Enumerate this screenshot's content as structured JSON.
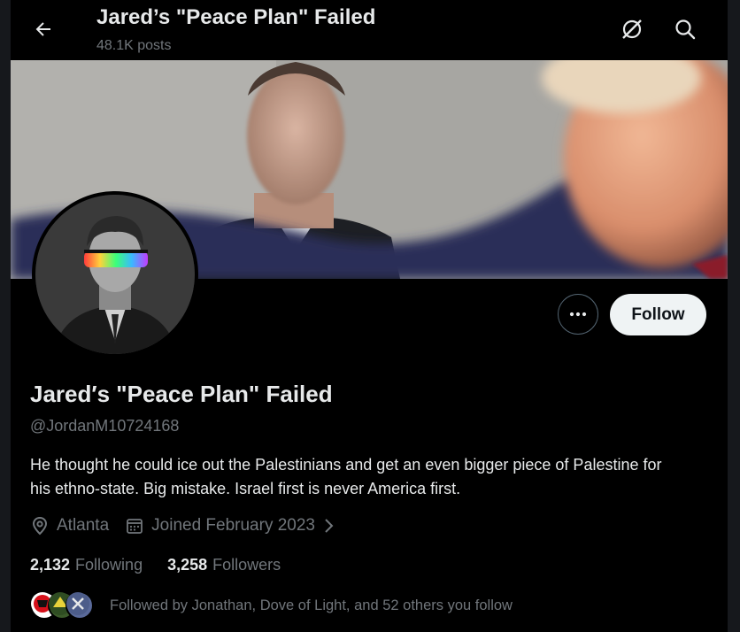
{
  "header": {
    "title": "Jared’s \"Peace Plan\" Failed",
    "posts": "48.1K posts"
  },
  "profile": {
    "display_name": "Jared′s \"Peace Plan\" Failed",
    "handle": "@JordanM10724168",
    "bio": "He thought he could ice out the Palestinians and get an even bigger piece of Palestine for his ethno-state. Big mistake. Israel first is never America first.",
    "location": "Atlanta",
    "joined": "Joined February 2023",
    "following_count": "2,132",
    "following_label": "Following",
    "followers_count": "3,258",
    "followers_label": "Followers",
    "followed_by": "Followed by Jonathan, Dove of Light, and 52 others you follow"
  },
  "actions": {
    "follow_label": "Follow"
  },
  "icons": {
    "back": "arrow-left-icon",
    "grok": "grok-icon",
    "search": "search-icon",
    "more": "more-horizontal-icon",
    "location": "location-pin-icon",
    "calendar": "calendar-icon",
    "chevron": "chevron-right-icon"
  },
  "colors": {
    "background": "#000000",
    "text_primary": "#e7e9ea",
    "text_secondary": "#71767b",
    "follow_button_bg": "#eff3f4"
  }
}
